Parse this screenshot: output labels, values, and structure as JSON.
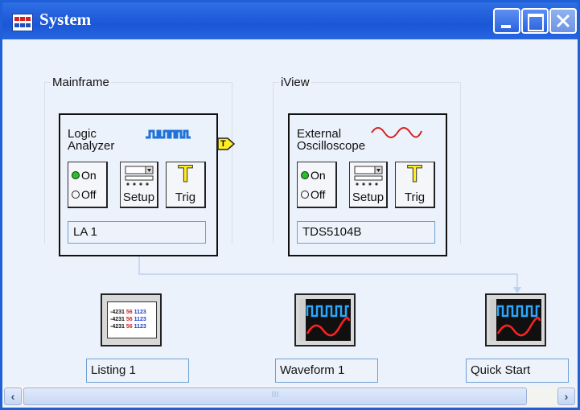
{
  "window": {
    "title": "System"
  },
  "groups": [
    {
      "label": "Mainframe"
    },
    {
      "label": "iView"
    }
  ],
  "modules": [
    {
      "title_line1": "Logic",
      "title_line2": "Analyzer",
      "on_label": "On",
      "off_label": "Off",
      "on_selected": true,
      "setup_label": "Setup",
      "trig_label": "Trig",
      "trig_glyph": "T",
      "name": "LA 1",
      "icon": "digital-waveform-icon"
    },
    {
      "title_line1": "External",
      "title_line2": "Oscilloscope",
      "on_label": "On",
      "off_label": "Off",
      "on_selected": true,
      "setup_label": "Setup",
      "trig_label": "Trig",
      "trig_glyph": "T",
      "name": "TDS5104B",
      "icon": "analog-sine-icon"
    }
  ],
  "trigger_port": {
    "label": "T"
  },
  "views": [
    {
      "name": "Listing 1",
      "icon": "listing-table-icon",
      "rows": [
        [
          "-4231",
          "56",
          "1123"
        ],
        [
          "-4231",
          "56",
          "1123"
        ],
        [
          "-4231",
          "56",
          "1123"
        ]
      ]
    },
    {
      "name": "Waveform 1",
      "icon": "waveform-display-icon"
    },
    {
      "name": "Quick Start",
      "icon": "waveform-display-icon"
    }
  ],
  "scrollbar": {
    "thumb_grip": "III"
  },
  "colors": {
    "titlebar": "#1a56d6",
    "led_on": "#22c322",
    "trig_yellow": "#ffee22",
    "digital_blue": "#1f72d8",
    "analog_red": "#d42020",
    "scope_screen": "#101010",
    "scope_trace_blue": "#2aa8ff",
    "scope_trace_red": "#ff2222"
  }
}
